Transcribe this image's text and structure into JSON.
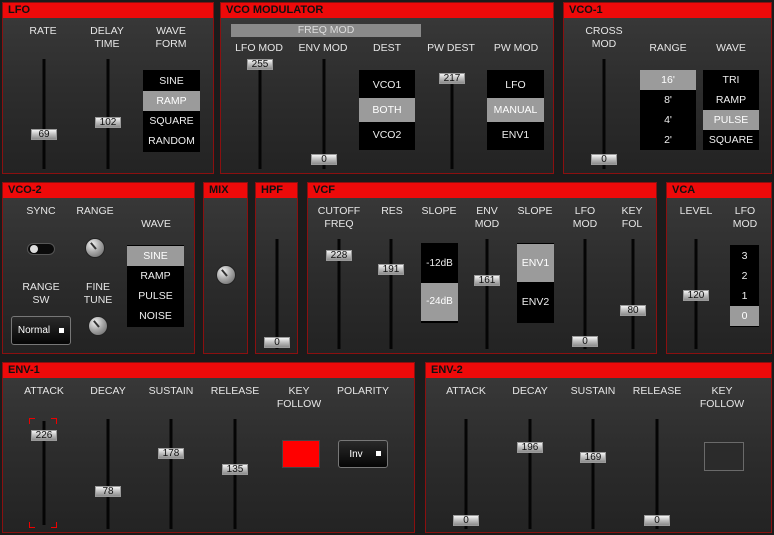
{
  "lfo": {
    "title": "LFO",
    "rate_label": "RATE",
    "delay_label": "DELAY\nTIME",
    "wave_label": "WAVE\nFORM",
    "rate_value": "69",
    "delay_value": "102",
    "waves": [
      "SINE",
      "RAMP",
      "SQUARE",
      "RANDOM"
    ],
    "wave_selected": "RAMP"
  },
  "vco_mod": {
    "title": "VCO MODULATOR",
    "freq_mod": "FREQ MOD",
    "lfo_mod_label": "LFO MOD",
    "env_mod_label": "ENV MOD",
    "dest_label": "DEST",
    "pw_dest_label": "PW DEST",
    "pw_mod_label": "PW MOD",
    "lfo_mod_value": "255",
    "env_mod_value": "0",
    "pw_dest_value": "217",
    "dest": [
      "VCO1",
      "BOTH",
      "VCO2"
    ],
    "dest_selected": "BOTH",
    "pw_mod": [
      "LFO",
      "MANUAL",
      "ENV1"
    ],
    "pw_mod_selected": "MANUAL"
  },
  "vco1": {
    "title": "VCO-1",
    "cross_mod_label": "CROSS\nMOD",
    "range_label": "RANGE",
    "wave_label": "WAVE",
    "cross_mod_value": "0",
    "ranges": [
      "16'",
      "8'",
      "4'",
      "2'"
    ],
    "range_selected": "16'",
    "waves": [
      "TRI",
      "RAMP",
      "PULSE",
      "SQUARE"
    ],
    "wave_selected": "PULSE"
  },
  "vco2": {
    "title": "VCO-2",
    "sync_label": "SYNC",
    "range_label": "RANGE",
    "wave_label": "WAVE",
    "range_sw_label": "RANGE\nSW",
    "fine_tune_label": "FINE\nTUNE",
    "range_sw_value": "Normal",
    "waves": [
      "SINE",
      "RAMP",
      "PULSE",
      "NOISE"
    ],
    "wave_selected": "SINE"
  },
  "mix": {
    "title": "MIX"
  },
  "hpf": {
    "title": "HPF",
    "value": "0"
  },
  "vcf": {
    "title": "VCF",
    "cutoff_label": "CUTOFF\nFREQ",
    "res_label": "RES",
    "slope_label": "SLOPE",
    "env_mod_label": "ENV\nMOD",
    "slope2_label": "SLOPE",
    "lfo_mod_label": "LFO\nMOD",
    "key_fol_label": "KEY\nFOL",
    "cutoff_value": "228",
    "res_value": "191",
    "env_mod_value": "161",
    "lfo_mod_value": "0",
    "key_fol_value": "80",
    "slopes": [
      "-12dB",
      "-24dB"
    ],
    "slope_selected": "-24dB",
    "env_slopes": [
      "ENV1",
      "ENV2"
    ],
    "env_slope_selected": "ENV1"
  },
  "vca": {
    "title": "VCA",
    "level_label": "LEVEL",
    "lfo_mod_label": "LFO\nMOD",
    "level_value": "120",
    "lfo_mod": [
      "3",
      "2",
      "1",
      "0"
    ],
    "lfo_mod_selected": "0"
  },
  "env1": {
    "title": "ENV-1",
    "attack_label": "ATTACK",
    "decay_label": "DECAY",
    "sustain_label": "SUSTAIN",
    "release_label": "RELEASE",
    "key_follow_label": "KEY\nFOLLOW",
    "polarity_label": "POLARITY",
    "attack_value": "226",
    "decay_value": "78",
    "sustain_value": "178",
    "release_value": "135",
    "polarity_value": "Inv"
  },
  "env2": {
    "title": "ENV-2",
    "attack_label": "ATTACK",
    "decay_label": "DECAY",
    "sustain_label": "SUSTAIN",
    "release_label": "RELEASE",
    "key_follow_label": "KEY\nFOLLOW",
    "attack_value": "0",
    "decay_value": "196",
    "sustain_value": "169",
    "release_value": "0"
  },
  "colors": {
    "accent": "#ee0a0a",
    "panel": "#2e2e2e",
    "selected": "#9b9b9b",
    "key_follow_on": "#ff0000"
  }
}
